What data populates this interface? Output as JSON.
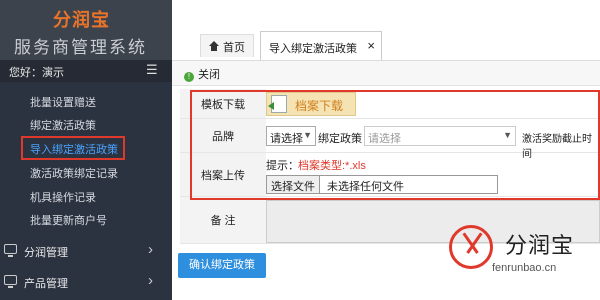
{
  "brand": {
    "name": "分润宝",
    "subtitle": "服务商管理系统"
  },
  "sidebar": {
    "greeting": "您好：演示",
    "items": [
      {
        "label": "批量设置赠送"
      },
      {
        "label": "绑定激活政策"
      },
      {
        "label": "导入绑定激活政策"
      },
      {
        "label": "激活政策绑定记录"
      },
      {
        "label": "机具操作记录"
      },
      {
        "label": "批量更新商户号"
      }
    ],
    "groups": [
      {
        "label": "分润管理"
      },
      {
        "label": "产品管理"
      }
    ]
  },
  "tabs": {
    "home": "首页",
    "active": "导入绑定激活政策",
    "close_glyph": "×"
  },
  "toolbar": {
    "close_label": "关闭"
  },
  "form": {
    "template_label": "模板下载",
    "download_button": "档案下载",
    "brand_label": "品牌",
    "brand_select": "请选择",
    "policy_label": "绑定政策",
    "policy_select": "请选择",
    "deadline_label": "激活奖励截止时间",
    "upload_label": "档案上传",
    "hint_prefix": "提示：",
    "hint_text": "档案类型:*.xls",
    "file_button": "选择文件",
    "file_status": "未选择任何文件",
    "remark_label": "备 注",
    "submit": "确认绑定政策"
  },
  "watermark": {
    "name": "分润宝",
    "domain": "fenrunbao.cn"
  },
  "colors": {
    "accent": "#e0382b",
    "sidebar_bg": "#2b3240",
    "active_link": "#4aa3ff",
    "submit_bg": "#2f8fdf",
    "brand_orange": "#e8742a"
  }
}
